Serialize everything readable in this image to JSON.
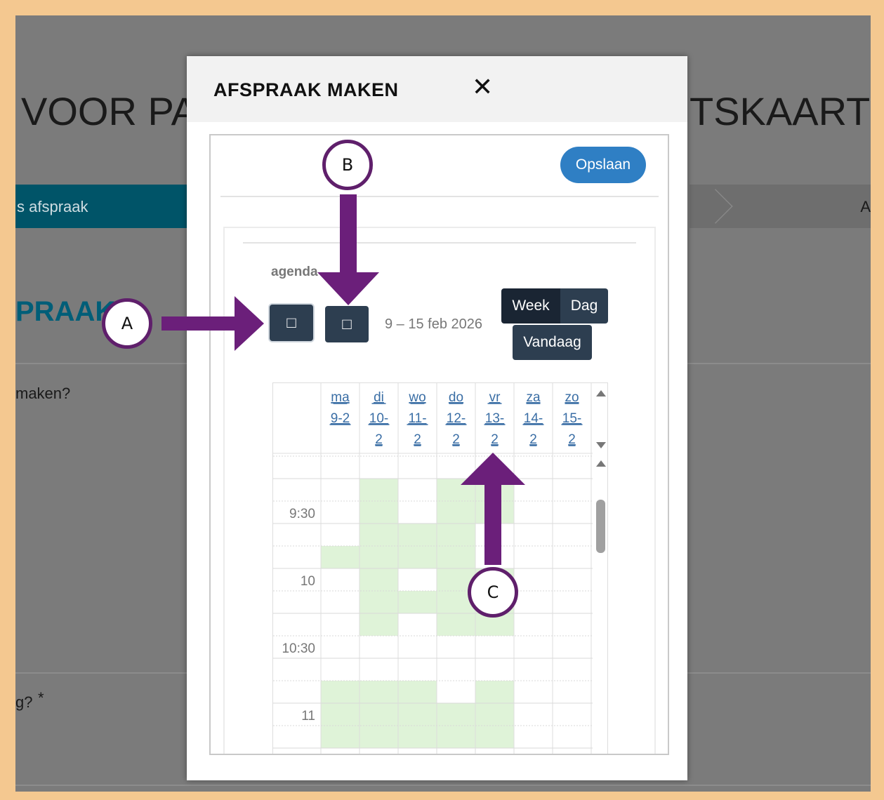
{
  "background": {
    "title_left": "VOOR PA",
    "title_right": "TSKAART",
    "breadcrumb_active": "s afspraak",
    "breadcrumb_next": "A",
    "heading": "PRAAK",
    "question1": "maken?",
    "question2": "g?",
    "required_mark": "*"
  },
  "modal": {
    "title": "AFSPRAAK MAKEN",
    "close_icon": "close-icon",
    "save_label": "Opslaan",
    "agenda_label": "agenda",
    "prev_label": "□",
    "next_label": "□",
    "date_range": "9 – 15 feb 2026",
    "views": {
      "week": "Week",
      "day": "Dag",
      "today": "Vandaag"
    }
  },
  "calendar": {
    "days": [
      {
        "lines": [
          "ma",
          "9-2"
        ]
      },
      {
        "lines": [
          "di",
          "10-",
          "2"
        ]
      },
      {
        "lines": [
          "wo",
          "11-",
          "2"
        ]
      },
      {
        "lines": [
          "do",
          "12-",
          "2"
        ]
      },
      {
        "lines": [
          "vr",
          "13-",
          "2"
        ]
      },
      {
        "lines": [
          "za",
          "14-",
          "2"
        ]
      },
      {
        "lines": [
          "zo",
          "15-",
          "2"
        ]
      }
    ],
    "time_labels": [
      "9:30",
      "10",
      "10:30",
      "11"
    ],
    "available_color": "#dff3d8",
    "availability_slots": [
      [
        0,
        0,
        0,
        0,
        0,
        0,
        0
      ],
      [
        0,
        1,
        0,
        1,
        1,
        0,
        0
      ],
      [
        0,
        1,
        0,
        1,
        1,
        0,
        0
      ],
      [
        0,
        1,
        1,
        1,
        0,
        0,
        0
      ],
      [
        1,
        1,
        1,
        1,
        0,
        0,
        0
      ],
      [
        0,
        1,
        0,
        1,
        1,
        0,
        0
      ],
      [
        0,
        1,
        1,
        1,
        1,
        0,
        0
      ],
      [
        0,
        1,
        0,
        1,
        1,
        0,
        0
      ],
      [
        0,
        0,
        0,
        0,
        0,
        0,
        0
      ],
      [
        0,
        0,
        0,
        0,
        0,
        0,
        0
      ],
      [
        1,
        1,
        1,
        0,
        1,
        0,
        0
      ],
      [
        1,
        1,
        1,
        1,
        1,
        0,
        0
      ],
      [
        1,
        1,
        1,
        1,
        1,
        0,
        0
      ]
    ]
  },
  "callouts": {
    "a": "A",
    "b": "B",
    "c": "C"
  },
  "annotation_color": "#6b1f7a"
}
